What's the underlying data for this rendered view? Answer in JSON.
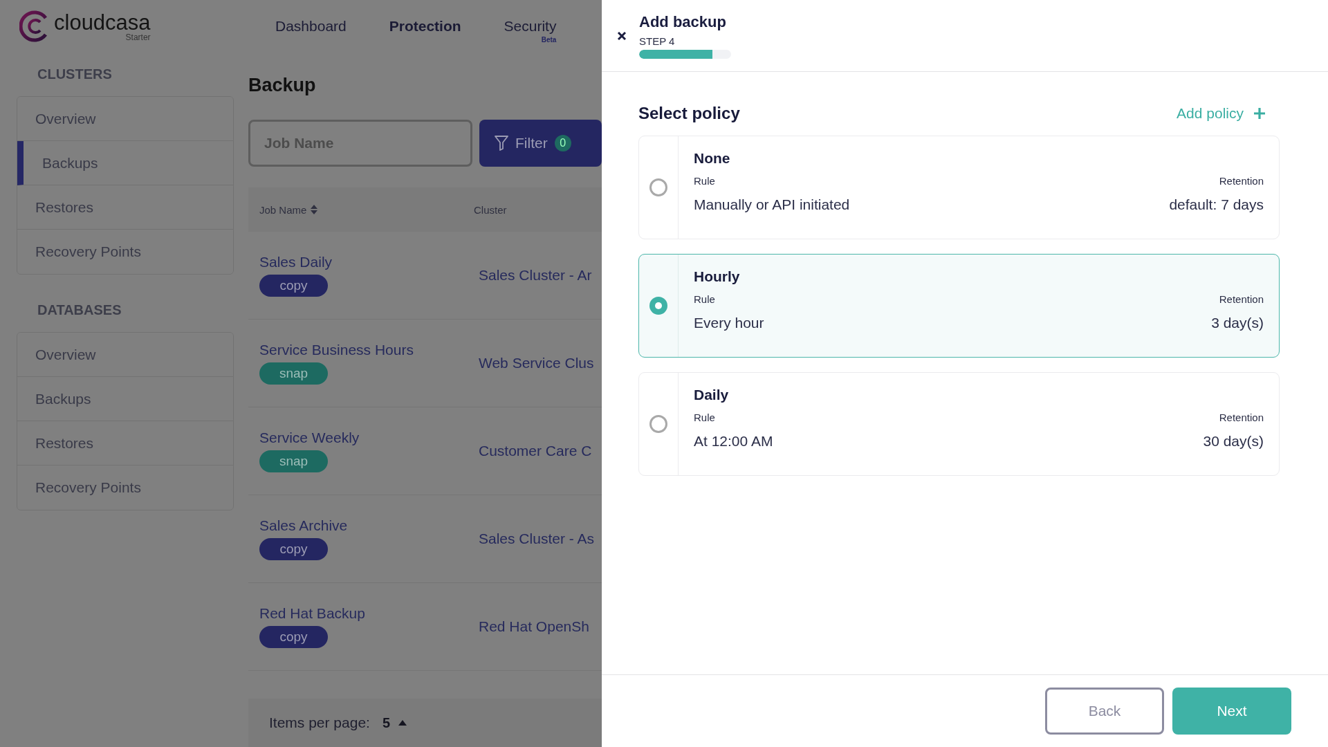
{
  "app": {
    "logo": "cloudcasa",
    "edition": "Starter"
  },
  "nav": [
    {
      "label": "Dashboard",
      "selected": false
    },
    {
      "label": "Protection",
      "selected": true
    },
    {
      "label": "Security",
      "badge": "Beta",
      "selected": false
    }
  ],
  "sidebar": {
    "sections": [
      {
        "title": "CLUSTERS",
        "items": [
          {
            "label": "Overview",
            "selected": false
          },
          {
            "label": "Backups",
            "selected": true
          },
          {
            "label": "Restores",
            "selected": false
          },
          {
            "label": "Recovery Points",
            "selected": false
          }
        ]
      },
      {
        "title": "DATABASES",
        "items": [
          {
            "label": "Overview",
            "selected": false
          },
          {
            "label": "Backups",
            "selected": false
          },
          {
            "label": "Restores",
            "selected": false
          },
          {
            "label": "Recovery Points",
            "selected": false
          }
        ]
      }
    ]
  },
  "page": {
    "title": "Backup",
    "search": {
      "placeholder": "Job Name"
    },
    "filter": {
      "label": "Filter",
      "count": "0"
    }
  },
  "table": {
    "columns": [
      {
        "label": "Job Name",
        "sortable": true
      },
      {
        "label": "Cluster",
        "sortable": false
      }
    ],
    "rows": [
      {
        "name": "Sales Daily",
        "tag": {
          "kind": "copy",
          "label": "copy"
        },
        "cluster": "Sales Cluster - Ar"
      },
      {
        "name": "Service Business Hours",
        "tag": {
          "kind": "snap",
          "label": "snap"
        },
        "cluster": "Web Service Clus"
      },
      {
        "name": "Service Weekly",
        "tag": {
          "kind": "snap",
          "label": "snap"
        },
        "cluster": "Customer Care C"
      },
      {
        "name": "Sales Archive",
        "tag": {
          "kind": "copy",
          "label": "copy"
        },
        "cluster": "Sales Cluster - As"
      },
      {
        "name": "Red Hat Backup",
        "tag": {
          "kind": "copy",
          "label": "copy"
        },
        "cluster": "Red Hat OpenSh"
      }
    ]
  },
  "pagination": {
    "label": "Items per page:",
    "value": "5"
  },
  "drawer": {
    "title": "Add backup",
    "step": "STEP 4",
    "progress": {
      "level": 0.8
    },
    "heading": "Select policy",
    "add_label": "Add policy",
    "policies": [
      {
        "name": "None",
        "rule_label": "Rule",
        "rule": "Manually or API initiated",
        "retention_label": "Retention",
        "retention": "default: 7 days",
        "selected": false
      },
      {
        "name": "Hourly",
        "rule_label": "Rule",
        "rule": "Every hour",
        "retention_label": "Retention",
        "retention": "3 day(s)",
        "selected": true
      },
      {
        "name": "Daily",
        "rule_label": "Rule",
        "rule": "At 12:00 AM",
        "retention_label": "Retention",
        "retention": "30 day(s)",
        "selected": false
      }
    ],
    "buttons": [
      {
        "label": "Back",
        "kind": "secondary"
      },
      {
        "label": "Next",
        "kind": "primary"
      }
    ]
  }
}
